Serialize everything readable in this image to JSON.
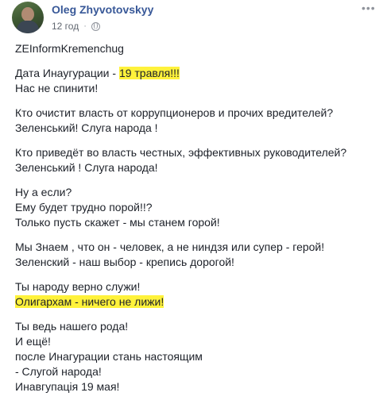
{
  "post": {
    "author": "Oleg Zhyvotovskyy",
    "timestamp": "12 год",
    "separator": "·",
    "more_label": "•••",
    "paragraphs": [
      [
        "ZEInformKremenchug"
      ],
      [
        "Дата Инаугурации - ",
        "19 травля!!!",
        "Нас не спинити!"
      ],
      [
        "Кто очистит власть от коррупционеров и прочих вредителей?",
        "Зеленський! Слуга народа !"
      ],
      [
        "Кто приведёт во власть честных, эффективных руководителей?",
        "Зеленський ! Слуга народа!"
      ],
      [
        "Ну а если?",
        "Ему будет трудно порой!!?",
        "Только пусть скажет - мы станем горой!"
      ],
      [
        "Мы Знаем , что он - человек, а не ниндзя или супер - герой!",
        "Зеленский - наш выбор - крепись дорогой!"
      ],
      [
        "Ты народу верно служи!",
        "Олигархам - ничего не лижи!"
      ],
      [
        "Ты ведь нашего рода!",
        "И ещё!",
        "после Инагурации стань настоящим",
        "- Слугой народа!",
        "Инавгупація 19 мая!"
      ]
    ]
  },
  "colors": {
    "author": "#385898",
    "text": "#1d2129",
    "meta": "#616770",
    "highlight": "#fff23b"
  },
  "icons": {
    "privacy": "globe-icon",
    "menu": "more-options-icon"
  }
}
